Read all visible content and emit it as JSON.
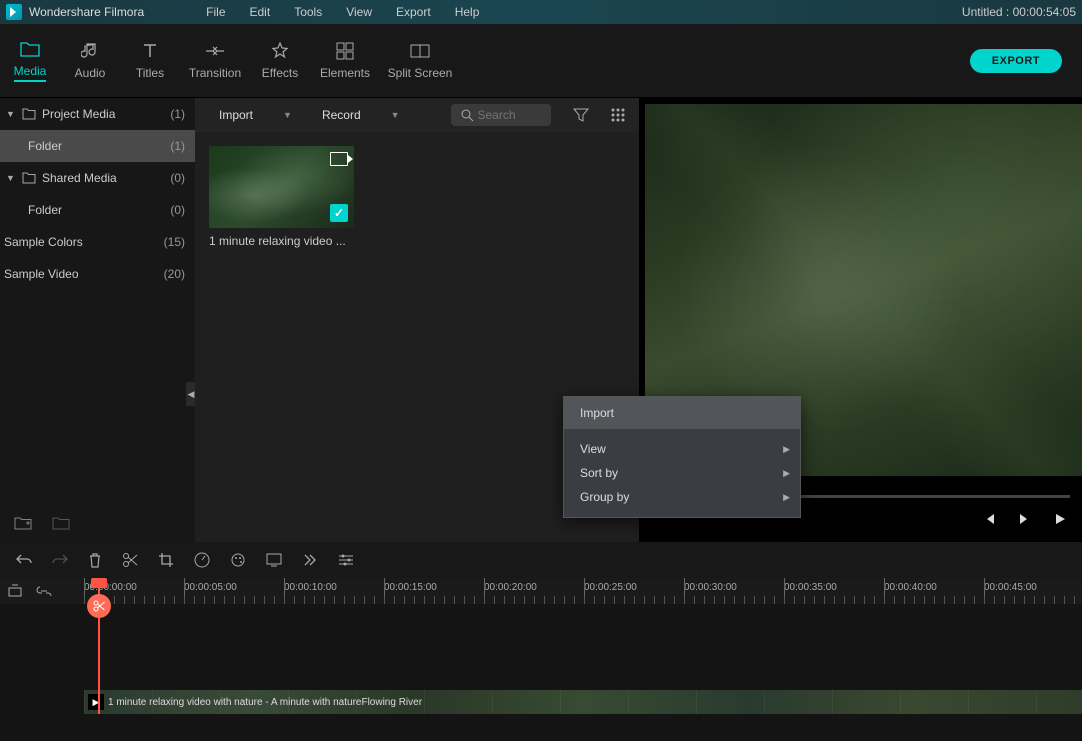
{
  "titlebar": {
    "app_name": "Wondershare Filmora",
    "project": "Untitled : 00:00:54:05"
  },
  "menubar": {
    "items": [
      "File",
      "Edit",
      "Tools",
      "View",
      "Export",
      "Help"
    ]
  },
  "tabs": [
    {
      "label": "Media",
      "icon": "folder-icon",
      "active": true
    },
    {
      "label": "Audio",
      "icon": "audio-icon"
    },
    {
      "label": "Titles",
      "icon": "titles-icon"
    },
    {
      "label": "Transition",
      "icon": "transition-icon"
    },
    {
      "label": "Effects",
      "icon": "effects-icon"
    },
    {
      "label": "Elements",
      "icon": "elements-icon"
    },
    {
      "label": "Split Screen",
      "icon": "split-icon"
    }
  ],
  "export_btn": "EXPORT",
  "tree": [
    {
      "label": "Project Media",
      "count": "(1)",
      "expand": true,
      "folder": true
    },
    {
      "label": "Folder",
      "count": "(1)",
      "child": true,
      "selected": true
    },
    {
      "label": "Shared Media",
      "count": "(0)",
      "expand": true,
      "folder": true
    },
    {
      "label": "Folder",
      "count": "(0)",
      "child": true
    },
    {
      "label": "Sample Colors",
      "count": "(15)"
    },
    {
      "label": "Sample Video",
      "count": "(20)"
    }
  ],
  "media_toolbar": {
    "import": "Import",
    "record": "Record",
    "search_ph": "Search"
  },
  "media_items": [
    {
      "name": "1 minute relaxing video ..."
    }
  ],
  "context_menu": {
    "items": [
      {
        "label": "Import",
        "top": true
      },
      {
        "label": "View",
        "sub": true
      },
      {
        "label": "Sort by",
        "sub": true
      },
      {
        "label": "Group by",
        "sub": true
      }
    ]
  },
  "ruler": [
    "00:00:00:00",
    "00:00:05:00",
    "00:00:10:00",
    "00:00:15:00",
    "00:00:20:00",
    "00:00:25:00",
    "00:00:30:00",
    "00:00:35:00",
    "00:00:40:00",
    "00:00:45:00"
  ],
  "clip_name": "1 minute relaxing video with nature - A minute with natureFlowing River"
}
